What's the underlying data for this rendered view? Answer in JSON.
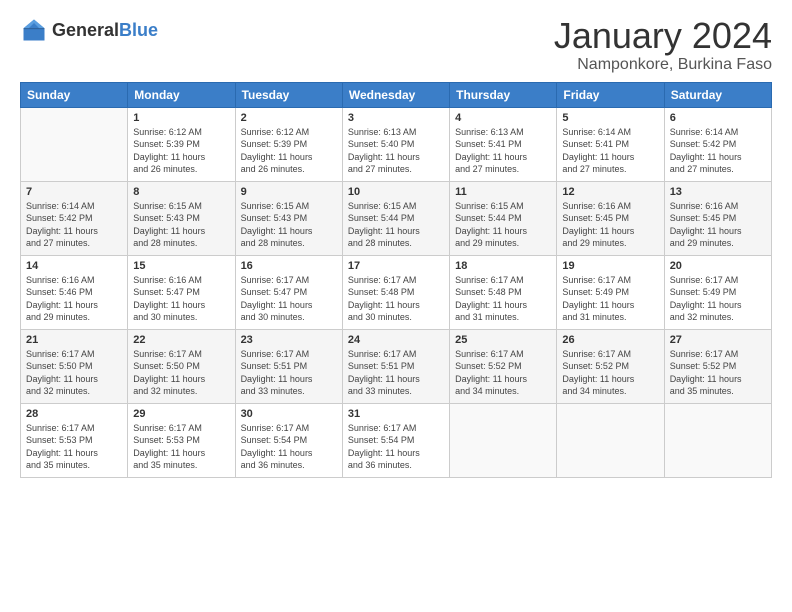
{
  "logo": {
    "general": "General",
    "blue": "Blue"
  },
  "header": {
    "title": "January 2024",
    "subtitle": "Namponkore, Burkina Faso"
  },
  "weekdays": [
    "Sunday",
    "Monday",
    "Tuesday",
    "Wednesday",
    "Thursday",
    "Friday",
    "Saturday"
  ],
  "weeks": [
    [
      {
        "day": "",
        "info": ""
      },
      {
        "day": "1",
        "info": "Sunrise: 6:12 AM\nSunset: 5:39 PM\nDaylight: 11 hours\nand 26 minutes."
      },
      {
        "day": "2",
        "info": "Sunrise: 6:12 AM\nSunset: 5:39 PM\nDaylight: 11 hours\nand 26 minutes."
      },
      {
        "day": "3",
        "info": "Sunrise: 6:13 AM\nSunset: 5:40 PM\nDaylight: 11 hours\nand 27 minutes."
      },
      {
        "day": "4",
        "info": "Sunrise: 6:13 AM\nSunset: 5:41 PM\nDaylight: 11 hours\nand 27 minutes."
      },
      {
        "day": "5",
        "info": "Sunrise: 6:14 AM\nSunset: 5:41 PM\nDaylight: 11 hours\nand 27 minutes."
      },
      {
        "day": "6",
        "info": "Sunrise: 6:14 AM\nSunset: 5:42 PM\nDaylight: 11 hours\nand 27 minutes."
      }
    ],
    [
      {
        "day": "7",
        "info": "Sunrise: 6:14 AM\nSunset: 5:42 PM\nDaylight: 11 hours\nand 27 minutes."
      },
      {
        "day": "8",
        "info": "Sunrise: 6:15 AM\nSunset: 5:43 PM\nDaylight: 11 hours\nand 28 minutes."
      },
      {
        "day": "9",
        "info": "Sunrise: 6:15 AM\nSunset: 5:43 PM\nDaylight: 11 hours\nand 28 minutes."
      },
      {
        "day": "10",
        "info": "Sunrise: 6:15 AM\nSunset: 5:44 PM\nDaylight: 11 hours\nand 28 minutes."
      },
      {
        "day": "11",
        "info": "Sunrise: 6:15 AM\nSunset: 5:44 PM\nDaylight: 11 hours\nand 29 minutes."
      },
      {
        "day": "12",
        "info": "Sunrise: 6:16 AM\nSunset: 5:45 PM\nDaylight: 11 hours\nand 29 minutes."
      },
      {
        "day": "13",
        "info": "Sunrise: 6:16 AM\nSunset: 5:45 PM\nDaylight: 11 hours\nand 29 minutes."
      }
    ],
    [
      {
        "day": "14",
        "info": "Sunrise: 6:16 AM\nSunset: 5:46 PM\nDaylight: 11 hours\nand 29 minutes."
      },
      {
        "day": "15",
        "info": "Sunrise: 6:16 AM\nSunset: 5:47 PM\nDaylight: 11 hours\nand 30 minutes."
      },
      {
        "day": "16",
        "info": "Sunrise: 6:17 AM\nSunset: 5:47 PM\nDaylight: 11 hours\nand 30 minutes."
      },
      {
        "day": "17",
        "info": "Sunrise: 6:17 AM\nSunset: 5:48 PM\nDaylight: 11 hours\nand 30 minutes."
      },
      {
        "day": "18",
        "info": "Sunrise: 6:17 AM\nSunset: 5:48 PM\nDaylight: 11 hours\nand 31 minutes."
      },
      {
        "day": "19",
        "info": "Sunrise: 6:17 AM\nSunset: 5:49 PM\nDaylight: 11 hours\nand 31 minutes."
      },
      {
        "day": "20",
        "info": "Sunrise: 6:17 AM\nSunset: 5:49 PM\nDaylight: 11 hours\nand 32 minutes."
      }
    ],
    [
      {
        "day": "21",
        "info": "Sunrise: 6:17 AM\nSunset: 5:50 PM\nDaylight: 11 hours\nand 32 minutes."
      },
      {
        "day": "22",
        "info": "Sunrise: 6:17 AM\nSunset: 5:50 PM\nDaylight: 11 hours\nand 32 minutes."
      },
      {
        "day": "23",
        "info": "Sunrise: 6:17 AM\nSunset: 5:51 PM\nDaylight: 11 hours\nand 33 minutes."
      },
      {
        "day": "24",
        "info": "Sunrise: 6:17 AM\nSunset: 5:51 PM\nDaylight: 11 hours\nand 33 minutes."
      },
      {
        "day": "25",
        "info": "Sunrise: 6:17 AM\nSunset: 5:52 PM\nDaylight: 11 hours\nand 34 minutes."
      },
      {
        "day": "26",
        "info": "Sunrise: 6:17 AM\nSunset: 5:52 PM\nDaylight: 11 hours\nand 34 minutes."
      },
      {
        "day": "27",
        "info": "Sunrise: 6:17 AM\nSunset: 5:52 PM\nDaylight: 11 hours\nand 35 minutes."
      }
    ],
    [
      {
        "day": "28",
        "info": "Sunrise: 6:17 AM\nSunset: 5:53 PM\nDaylight: 11 hours\nand 35 minutes."
      },
      {
        "day": "29",
        "info": "Sunrise: 6:17 AM\nSunset: 5:53 PM\nDaylight: 11 hours\nand 35 minutes."
      },
      {
        "day": "30",
        "info": "Sunrise: 6:17 AM\nSunset: 5:54 PM\nDaylight: 11 hours\nand 36 minutes."
      },
      {
        "day": "31",
        "info": "Sunrise: 6:17 AM\nSunset: 5:54 PM\nDaylight: 11 hours\nand 36 minutes."
      },
      {
        "day": "",
        "info": ""
      },
      {
        "day": "",
        "info": ""
      },
      {
        "day": "",
        "info": ""
      }
    ]
  ]
}
